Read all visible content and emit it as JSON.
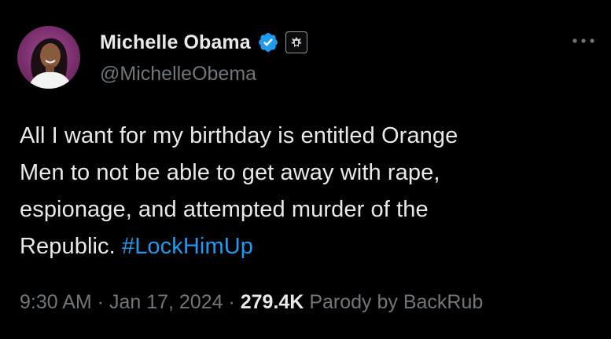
{
  "author": {
    "display_name": "Michelle Obama",
    "handle": "@MichelleObema",
    "verified": true,
    "affiliate_badge": "seal-icon",
    "avatar": "profile-photo"
  },
  "tweet": {
    "text_lines": [
      "All I want for my birthday is entitled Orange",
      "Men to not be able to get away with rape,",
      "espionage, and attempted murder of the",
      "Republic. "
    ],
    "hashtag": "#LockHimUp"
  },
  "meta": {
    "time": "9:30 AM",
    "sep1": " · ",
    "date": "Jan 17, 2024",
    "sep2": " · ",
    "views": "279.4K",
    "source": " Parody by BackRub"
  },
  "icons": {
    "more": "more-horizontal-icon",
    "verified": "verified-badge-icon"
  },
  "colors": {
    "background": "#000000",
    "primary_text": "#e7e9ea",
    "secondary_text": "#71767b",
    "link": "#1d9bf0",
    "verified": "#1d9bf0"
  }
}
